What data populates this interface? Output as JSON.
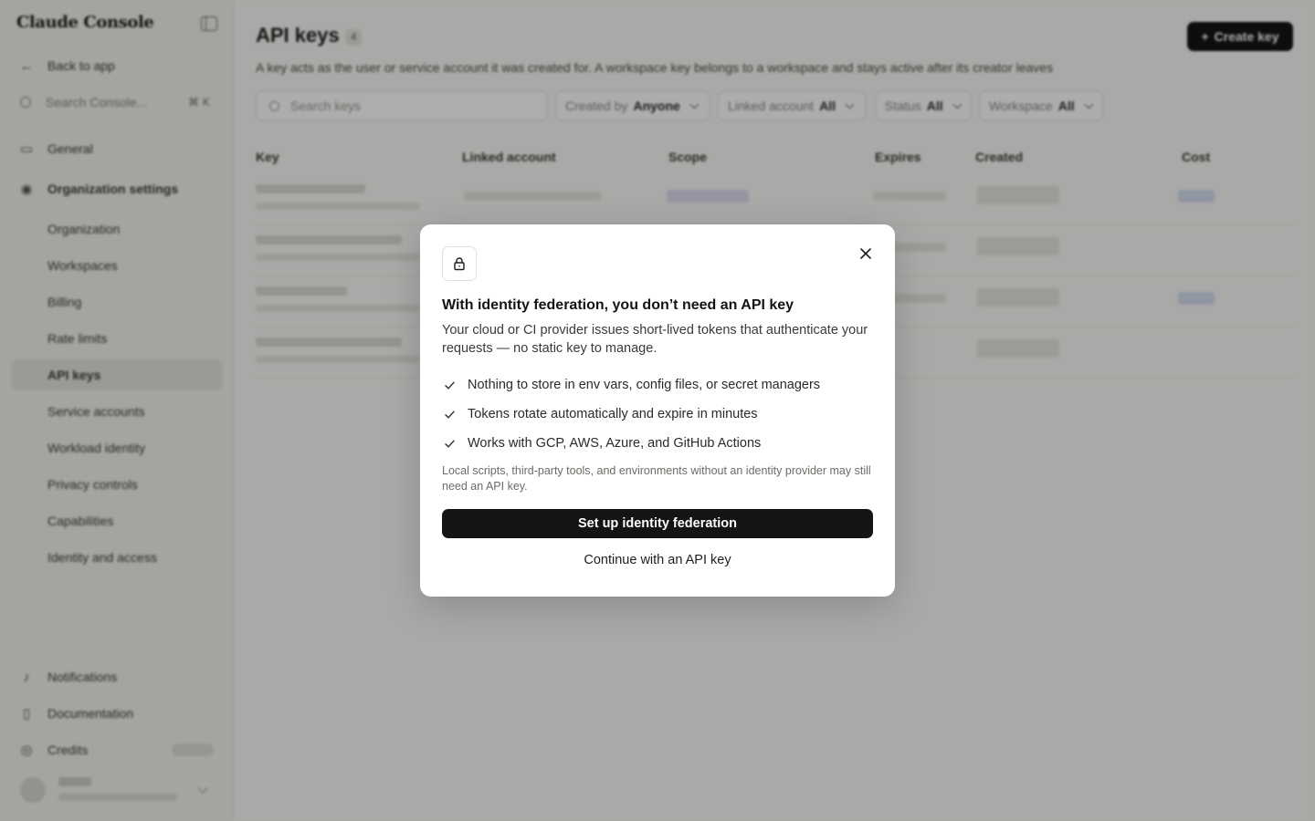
{
  "sidebar": {
    "brand": "Claude Console",
    "back_label": "Back to app",
    "search_placeholder": "Search Console...",
    "search_shortcut": "⌘K",
    "items": [
      {
        "label": "General"
      },
      {
        "label": "Organization settings"
      },
      {
        "label": "Organization"
      },
      {
        "label": "Workspaces"
      },
      {
        "label": "Billing"
      },
      {
        "label": "Rate limits"
      },
      {
        "label": "API keys"
      },
      {
        "label": "Service accounts"
      },
      {
        "label": "Workload identity"
      },
      {
        "label": "Privacy controls"
      },
      {
        "label": "Capabilities"
      },
      {
        "label": "Identity and access"
      }
    ],
    "footer": [
      {
        "label": "Notifications"
      },
      {
        "label": "Documentation"
      },
      {
        "label": "Credits"
      }
    ]
  },
  "main": {
    "title": "API keys",
    "count": "4",
    "create_label": "Create key",
    "subtitle": "A key acts as the user or service account it was created for. A workspace key belongs to a workspace and stays active after its creator leaves",
    "search_placeholder": "Search keys",
    "filters": [
      {
        "label": "Created by",
        "value": "Anyone"
      },
      {
        "label": "Linked account",
        "value": "All"
      },
      {
        "label": "Status",
        "value": "All"
      },
      {
        "label": "Workspace",
        "value": "All"
      }
    ],
    "columns": [
      "Key",
      "Linked account",
      "Scope",
      "Expires",
      "Created",
      "Cost"
    ]
  },
  "modal": {
    "title": "With identity federation, you don’t need an API key",
    "body": "Your cloud or CI provider issues short-lived tokens that authenticate your requests — no static key to manage.",
    "benefits": [
      "Nothing to store in env vars, config files, or secret managers",
      "Tokens rotate automatically and expire in minutes",
      "Works with GCP, AWS, Azure, and GitHub Actions"
    ],
    "note": "Local scripts, third-party tools, and environments without an identity provider may still need an API key.",
    "primary_label": "Set up identity federation",
    "secondary_label": "Continue with an API key"
  }
}
